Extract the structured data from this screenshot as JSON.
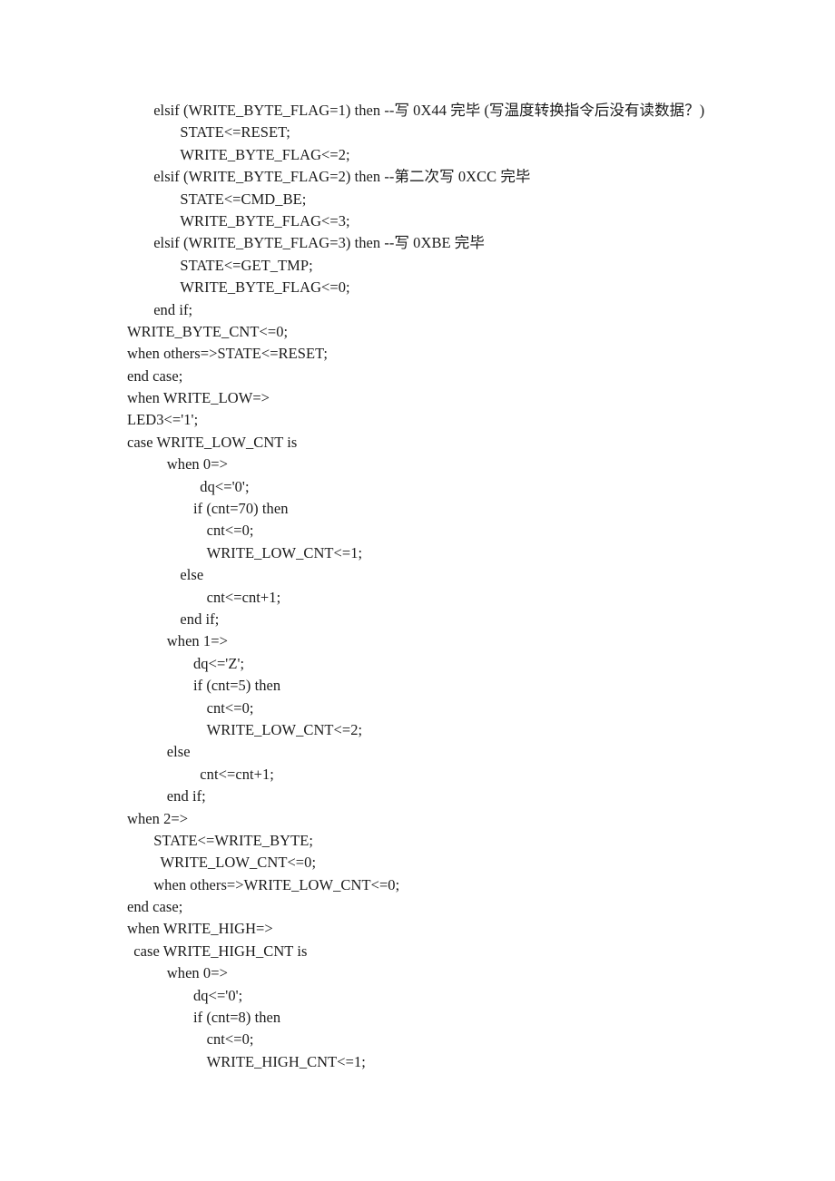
{
  "document": {
    "type": "scanned-code-listing",
    "language": "VHDL",
    "page_background": "#ffffff",
    "text_color": "#1b1b1b"
  },
  "code": {
    "lines": [
      {
        "indent": "i2",
        "text": "elsif (WRITE_BYTE_FLAG=1) then --写 0X44 完毕 (写温度转换指令后没有读数据？)"
      },
      {
        "indent": "i4",
        "text": "STATE<=RESET;"
      },
      {
        "indent": "i4",
        "text": "WRITE_BYTE_FLAG<=2;"
      },
      {
        "indent": "i2",
        "text": "elsif (WRITE_BYTE_FLAG=2) then --第二次写 0XCC 完毕"
      },
      {
        "indent": "i4",
        "text": "STATE<=CMD_BE;"
      },
      {
        "indent": "i4",
        "text": "WRITE_BYTE_FLAG<=3;"
      },
      {
        "indent": "i2",
        "text": "elsif (WRITE_BYTE_FLAG=3) then --写 0XBE 完毕"
      },
      {
        "indent": "i4",
        "text": "STATE<=GET_TMP;"
      },
      {
        "indent": "i4",
        "text": "WRITE_BYTE_FLAG<=0;"
      },
      {
        "indent": "i2",
        "text": "end if;"
      },
      {
        "indent": "i0",
        "text": "WRITE_BYTE_CNT<=0;"
      },
      {
        "indent": "i0",
        "text": "when others=>STATE<=RESET;"
      },
      {
        "indent": "i0",
        "text": "end case;"
      },
      {
        "indent": "i0",
        "text": "when WRITE_LOW=>"
      },
      {
        "indent": "i0",
        "text": "LED3<='1';"
      },
      {
        "indent": "i0",
        "text": "case WRITE_LOW_CNT is"
      },
      {
        "indent": "i3",
        "text": "when 0=>"
      },
      {
        "indent": "i5half",
        "text": "dq<='0';"
      },
      {
        "indent": "i5",
        "text": "if (cnt=70) then"
      },
      {
        "indent": "i6",
        "text": "cnt<=0;"
      },
      {
        "indent": "i6",
        "text": "WRITE_LOW_CNT<=1;"
      },
      {
        "indent": "i4",
        "text": "else"
      },
      {
        "indent": "i6",
        "text": "cnt<=cnt+1;"
      },
      {
        "indent": "i4",
        "text": "end if;"
      },
      {
        "indent": "i3",
        "text": "when 1=>"
      },
      {
        "indent": "i5",
        "text": "dq<='Z';"
      },
      {
        "indent": "i5",
        "text": "if (cnt=5) then"
      },
      {
        "indent": "i6",
        "text": "cnt<=0;"
      },
      {
        "indent": "i6",
        "text": "WRITE_LOW_CNT<=2;"
      },
      {
        "indent": "i3",
        "text": "else"
      },
      {
        "indent": "i5half",
        "text": "cnt<=cnt+1;"
      },
      {
        "indent": "i3",
        "text": "end if;"
      },
      {
        "indent": "i0",
        "text": "when 2=>"
      },
      {
        "indent": "i2",
        "text": "STATE<=WRITE_BYTE;"
      },
      {
        "indent": "i2half",
        "text": "WRITE_LOW_CNT<=0;"
      },
      {
        "indent": "i2",
        "text": "when others=>WRITE_LOW_CNT<=0;"
      },
      {
        "indent": "i0",
        "text": "end case;"
      },
      {
        "indent": "i0",
        "text": "when WRITE_HIGH=>"
      },
      {
        "indent": "ihalf",
        "text": "case WRITE_HIGH_CNT is"
      },
      {
        "indent": "i3",
        "text": "when 0=>"
      },
      {
        "indent": "i5",
        "text": "dq<='0';"
      },
      {
        "indent": "i5",
        "text": "if (cnt=8) then"
      },
      {
        "indent": "i6",
        "text": "cnt<=0;"
      },
      {
        "indent": "i6",
        "text": "WRITE_HIGH_CNT<=1;"
      }
    ]
  }
}
